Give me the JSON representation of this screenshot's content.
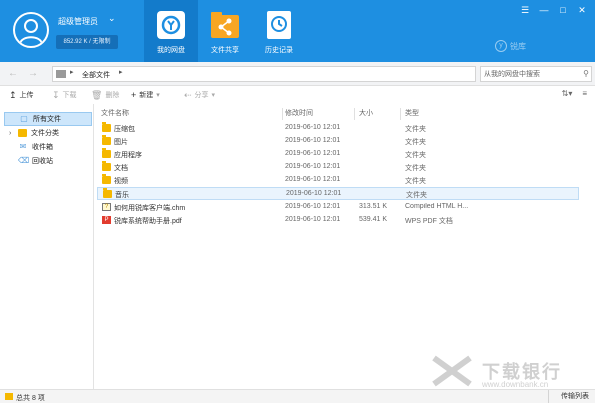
{
  "header": {
    "username": "超级管理员",
    "storage": "852.92 K / 无限制",
    "nav_tabs": [
      {
        "label": "我的网盘",
        "active": true
      },
      {
        "label": "文件共享",
        "active": false
      },
      {
        "label": "历史记录",
        "active": false
      }
    ],
    "brand": "锐库"
  },
  "address": {
    "path": "全部文件",
    "search_placeholder": "从我的网盘中搜索"
  },
  "toolbar": {
    "upload": "上传",
    "download": "下载",
    "delete": "删除",
    "new": "新建",
    "share": "分享"
  },
  "sidebar": {
    "items": [
      {
        "label": "所有文件",
        "active": true
      },
      {
        "label": "文件分类",
        "active": false
      },
      {
        "label": "收件箱",
        "active": false
      },
      {
        "label": "回收站",
        "active": false
      }
    ]
  },
  "columns": [
    "文件名称",
    "修改时间",
    "大小",
    "类型"
  ],
  "files": [
    {
      "name": "压缩包",
      "modified": "2019-06-10 12:01",
      "size": "",
      "type": "文件夹",
      "icon": "folder"
    },
    {
      "name": "图片",
      "modified": "2019-06-10 12:01",
      "size": "",
      "type": "文件夹",
      "icon": "folder"
    },
    {
      "name": "应用程序",
      "modified": "2019-06-10 12:01",
      "size": "",
      "type": "文件夹",
      "icon": "folder"
    },
    {
      "name": "文档",
      "modified": "2019-06-10 12:01",
      "size": "",
      "type": "文件夹",
      "icon": "folder"
    },
    {
      "name": "视频",
      "modified": "2019-06-10 12:01",
      "size": "",
      "type": "文件夹",
      "icon": "folder"
    },
    {
      "name": "音乐",
      "modified": "2019-06-10 12:01",
      "size": "",
      "type": "文件夹",
      "icon": "folder",
      "selected": true
    },
    {
      "name": "如何用锐库客户端.chm",
      "modified": "2019-06-10 12:01",
      "size": "313.51 K",
      "type": "Compiled HTML H...",
      "icon": "chm"
    },
    {
      "name": "锐库系统帮助手册.pdf",
      "modified": "2019-06-10 12:01",
      "size": "539.41 K",
      "type": "WPS PDF 文档",
      "icon": "pdf"
    }
  ],
  "status": {
    "count": "总共 8 项",
    "transfer": "传输列表"
  },
  "watermark": {
    "text": "下载银行",
    "url": "www.downbank.cn"
  }
}
